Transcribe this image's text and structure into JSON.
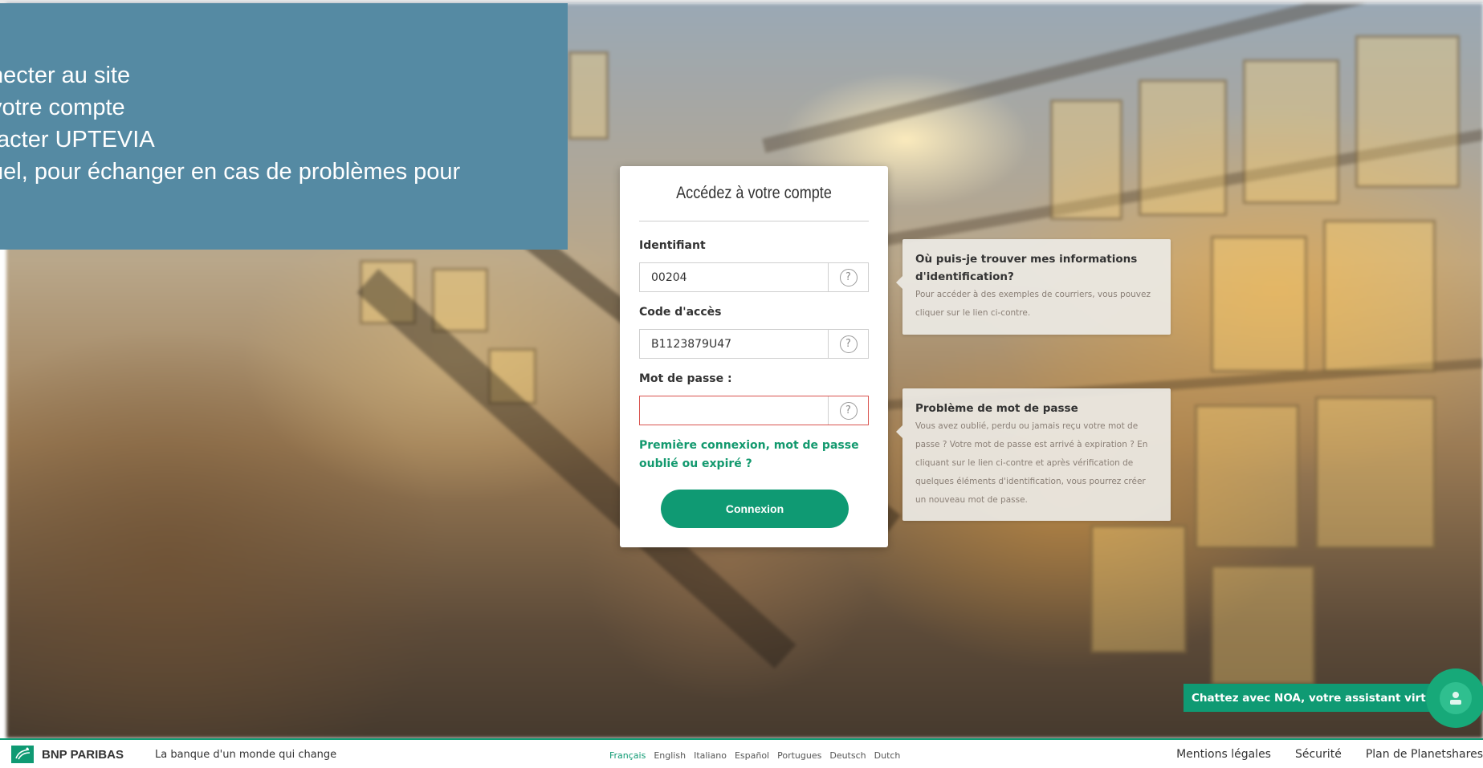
{
  "note": {
    "lines": [
      ":",
      "necter au site",
      "votre compte",
      "tacter UPTEVIA",
      "uel, pour échanger en cas de problèmes pour"
    ]
  },
  "login": {
    "title": "Accédez à votre compte",
    "identifiant_label": "Identifiant",
    "identifiant_value": "00204",
    "code_label": "Code d'accès",
    "code_value": "B1123879U47",
    "password_label": "Mot de passe :",
    "password_value": "",
    "help_symbol": "?",
    "forgot_link": "Première connexion, mot de passe oublié ou expiré ?",
    "connect_button": "Connexion"
  },
  "info_identification": {
    "title": "Où puis-je trouver mes informations d'identification?",
    "text": "Pour accéder à des exemples de courriers, vous pouvez cliquer sur le lien ci-contre."
  },
  "info_password": {
    "title": "Problème de mot de passe",
    "text": "Vous avez oublié, perdu ou jamais reçu votre mot de passe ? Votre mot de passe est arrivé à expiration ? En cliquant sur le lien ci-contre et après vérification de quelques éléments d'identification, vous pourrez créer un nouveau mot de passe."
  },
  "chat": {
    "label": "Chattez avec NOA, votre assistant virtuel",
    "icon": "chat-assistant-icon"
  },
  "footer": {
    "brand": "BNP PARIBAS",
    "tagline": "La banque d'un monde qui change",
    "languages": [
      "Français",
      "English",
      "Italiano",
      "Español",
      "Portugues",
      "Deutsch",
      "Dutch"
    ],
    "active_language": "Français",
    "links": [
      "Mentions légales",
      "Sécurité",
      "Plan de Planetshares"
    ]
  },
  "colors": {
    "accent": "#0f9a73",
    "note_bg": "#558aa3",
    "error_border": "#d9534f"
  }
}
